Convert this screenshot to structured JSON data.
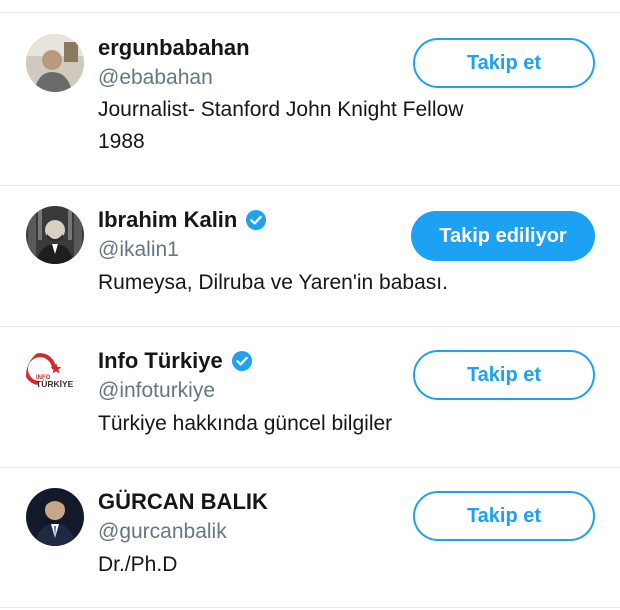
{
  "users": [
    {
      "display_name": "ergunbabahan",
      "handle": "@ebabahan",
      "bio_line1": "Journalist- Stanford John Knight Fellow",
      "bio_line2": "1988",
      "verified": false,
      "follow_label": "Takip et",
      "following": false
    },
    {
      "display_name": "Ibrahim Kalin",
      "handle": "@ikalin1",
      "bio_line1": "Rumeysa, Dilruba ve Yaren'in babası.",
      "verified": true,
      "follow_label": "Takip ediliyor",
      "following": true
    },
    {
      "display_name": "Info Türkiye",
      "handle": "@infoturkiye",
      "bio_line1": "Türkiye hakkında güncel bilgiler",
      "verified": true,
      "follow_label": "Takip et",
      "following": false,
      "avatar_logo_text": "INFO TÜRKİYE"
    },
    {
      "display_name": "GÜRCAN BALIK",
      "handle": "@gurcanbalik",
      "bio_line1": "Dr./Ph.D",
      "verified": false,
      "follow_label": "Takip et",
      "following": false
    }
  ],
  "colors": {
    "accent": "#1da1f2",
    "secondary_text": "#657786",
    "divider": "#e1e8ed"
  }
}
